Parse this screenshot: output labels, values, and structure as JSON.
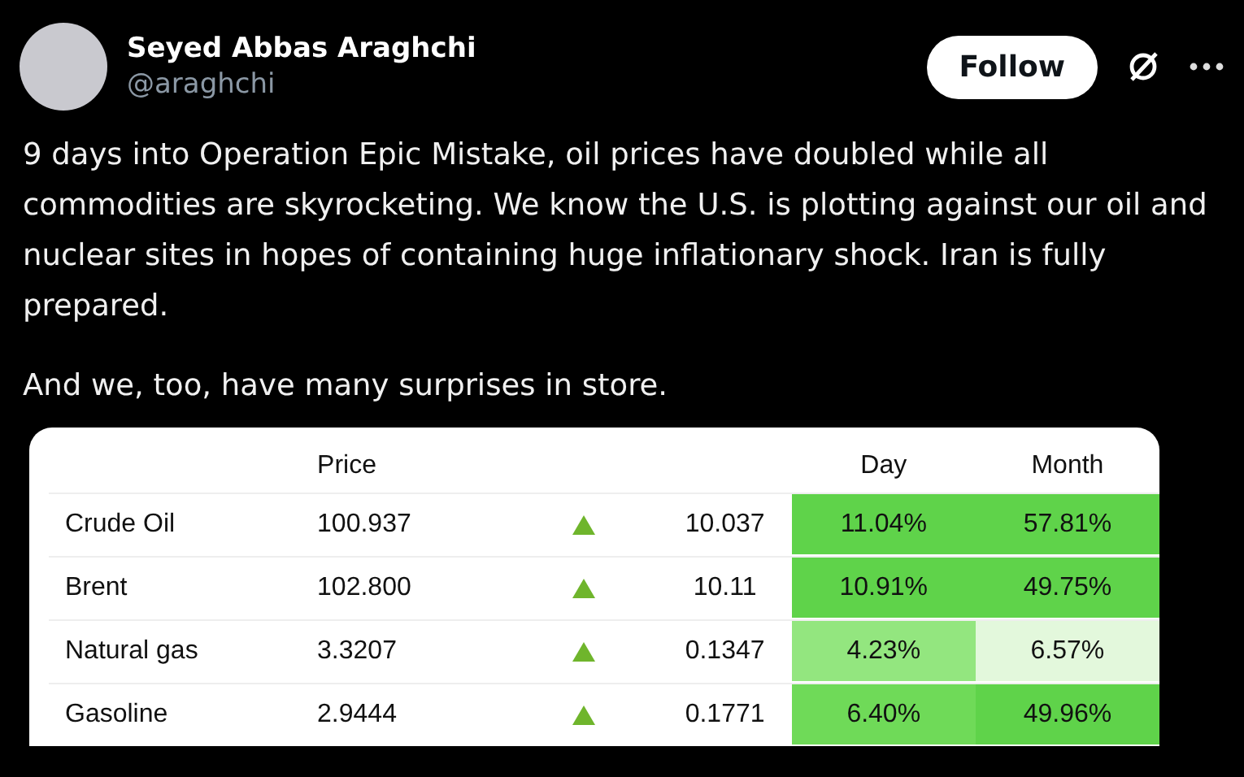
{
  "post": {
    "author": "Seyed Abbas Araghchi",
    "handle": "@araghchi",
    "follow_button": "Follow",
    "paragraphs": [
      "9 days into Operation Epic Mistake, oil prices have doubled while all commodities are skyrocketing. We know the U.S. is plotting against our oil and nuclear sites in hopes of containing huge inflationary shock. Iran is fully prepared.",
      "And we, too, have many surprises in store."
    ]
  },
  "table": {
    "columns": {
      "price": "Price",
      "day": "Day",
      "month": "Month"
    },
    "rows": [
      {
        "name": "Crude Oil",
        "price": "100.937",
        "kind": "up",
        "change": "10.037",
        "day": {
          "text": "11.04%",
          "color": "#5fd34a"
        },
        "month": {
          "text": "57.81%",
          "color": "#5fd34a"
        }
      },
      {
        "name": "Brent",
        "price": "102.800",
        "kind": "up",
        "change": "10.11",
        "day": {
          "text": "10.91%",
          "color": "#5fd34a"
        },
        "month": {
          "text": "49.75%",
          "color": "#5fd34a"
        }
      },
      {
        "name": "Natural gas",
        "price": "3.3207",
        "kind": "up",
        "change": "0.1347",
        "day": {
          "text": "4.23%",
          "color": "#93e67f"
        },
        "month": {
          "text": "6.57%",
          "color": "#e3f8dc"
        }
      },
      {
        "name": "Gasoline",
        "price": "2.9444",
        "kind": "up",
        "change": "0.1771",
        "day": {
          "text": "6.40%",
          "color": "#6fda58"
        },
        "month": {
          "text": "49.96%",
          "color": "#5fd34a"
        }
      }
    ]
  }
}
